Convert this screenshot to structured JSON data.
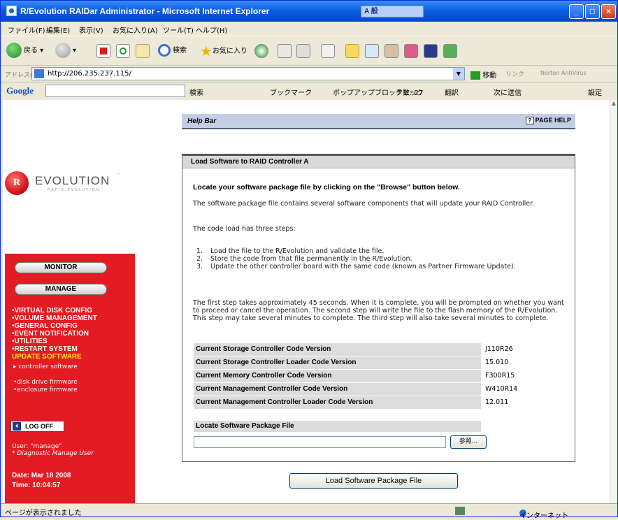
{
  "window": {
    "title": "R/Evolution RAIDar Administrator - Microsoft Internet Explorer",
    "ime_text": "A 般"
  },
  "menu": [
    "ファイル(F)",
    "編集(E)",
    "表示(V)",
    "お気に入り(A)",
    "ツール(T)",
    "ヘルプ(H)"
  ],
  "toolbar": {
    "back_label": "戻る",
    "search_label": "検索",
    "favorites_label": "お気に入り"
  },
  "address": {
    "label": "アドレス(D)",
    "url": "http://206.235.237.115/",
    "go_label": "移動",
    "links_label": "リンク",
    "norton_label": "Norton AntiVirus"
  },
  "google_bar": {
    "brand": "Google",
    "search_label": "検索",
    "bookmarks_label": "ブックマーク",
    "popup_label": "ポップアップブロック数: 27",
    "check_label": "チェック",
    "translate_label": "翻訳",
    "send_label": "次に送信",
    "settings_label": "設定"
  },
  "logo": {
    "initial": "R",
    "word": "EVOLUTION",
    "sub": "RAPID EVOLUTION",
    "tm": "™"
  },
  "sidebar": {
    "monitor_label": "MONITOR",
    "manage_label": "MANAGE",
    "links": [
      "•VIRTUAL DISK CONFIG",
      "•VOLUME MANAGEMENT",
      "•GENERAL CONFIG",
      "•EVENT NOTIFICATION",
      "•UTILITIES",
      "•RESTART SYSTEM"
    ],
    "current": "UPDATE SOFTWARE",
    "sublinks": [
      "▸ controller software",
      "•disk drive firmware",
      "•enclosure firmware"
    ],
    "logoff_label": "LOG OFF",
    "user_line": "User: \"manage\"",
    "role_line": "* Diagnostic Manage User",
    "date_line": "Date: Mar 18 2008",
    "time_line": "Time: 10:04:57"
  },
  "helpbar": {
    "title": "Help Bar",
    "page_help_label": "PAGE HELP"
  },
  "panel": {
    "title": "Load Software to RAID Controller A",
    "instruction": "Locate your software package file by clicking on the \"Browse\" button below.",
    "intro": "The software package file contains several software components that will update your RAID Controller.",
    "steps_intro": "The code load has three steps:",
    "steps": [
      {
        "n": "1.",
        "text": "Load the file to the R/Evolution and validate the file."
      },
      {
        "n": "2.",
        "text": "Store the code from that file permanently in the R/Evolution."
      },
      {
        "n": "3.",
        "text": "Update the other controller board with the same code (known as Partner Firmware Update)."
      }
    ],
    "timing": "The first step takes approximately 45 seconds. When it is complete, you will be prompted on whether you want to proceed or cancel the operation. The second step will write the file to the flash memory of the R/Evolution. This step may take several minutes to complete. The third step will also take several minutes to complete.",
    "versions": [
      {
        "label": "Current Storage Controller Code Version",
        "value": "J110R26"
      },
      {
        "label": "Current Storage Controller Loader Code Version",
        "value": "15.010"
      },
      {
        "label": "Current Memory Controller Code Version",
        "value": "F300R15"
      },
      {
        "label": "Current Management Controller Code Version",
        "value": "W410R14"
      },
      {
        "label": "Current Management Controller Loader Code Version",
        "value": "12.011"
      }
    ],
    "locate_label": "Locate Software Package File",
    "file_value": "",
    "browse_label": "参照..."
  },
  "load_button_label": "Load Software Package File",
  "status": {
    "text": "ページが表示されました",
    "zone": "インターネット"
  }
}
